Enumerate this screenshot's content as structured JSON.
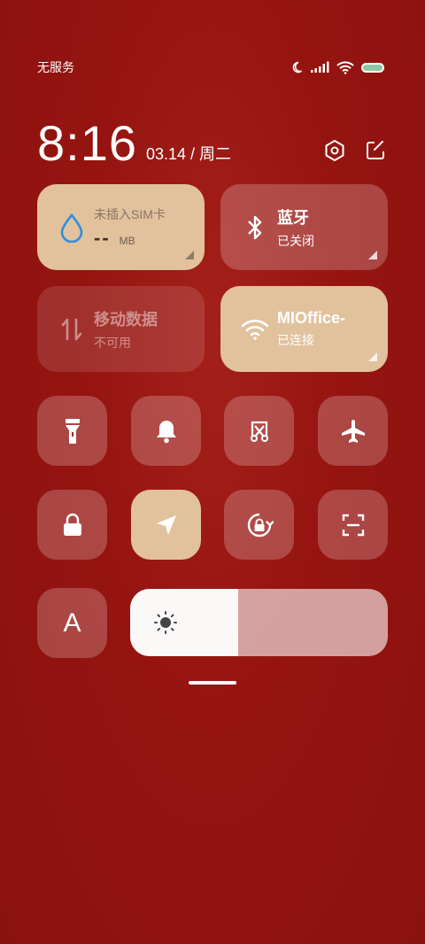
{
  "status_bar": {
    "carrier": "无服务"
  },
  "header": {
    "time": "8:16",
    "date": "03.14 / 周二"
  },
  "tiles": {
    "data_usage": {
      "title": "未插入SIM卡",
      "value": "--",
      "unit": "MB"
    },
    "bluetooth": {
      "title": "蓝牙",
      "status": "已关闭"
    },
    "mobile_data": {
      "title": "移动数据",
      "status": "不可用"
    },
    "wifi": {
      "title": "MIOffice-",
      "status": "已连接"
    }
  },
  "quick_toggles": [
    {
      "name": "flashlight",
      "icon": "flashlight-icon",
      "active": false
    },
    {
      "name": "ring",
      "icon": "bell-icon",
      "active": false
    },
    {
      "name": "screenshot",
      "icon": "screenshot-scissors-icon",
      "active": false
    },
    {
      "name": "airplane-mode",
      "icon": "airplane-icon",
      "active": false
    },
    {
      "name": "lock-screen",
      "icon": "lock-icon",
      "active": false
    },
    {
      "name": "location",
      "icon": "location-arrow-icon",
      "active": true
    },
    {
      "name": "auto-rotate",
      "icon": "rotation-lock-icon",
      "active": false
    },
    {
      "name": "scanner",
      "icon": "scan-icon",
      "active": false
    }
  ],
  "auto_brightness": {
    "label": "A"
  },
  "brightness": {
    "level": 0.42
  },
  "colors": {
    "background": "#951410",
    "tile_active": "#e1c29c",
    "tile_inactive": "rgba(255,255,255,0.22)",
    "battery": "#8cc7a3"
  }
}
